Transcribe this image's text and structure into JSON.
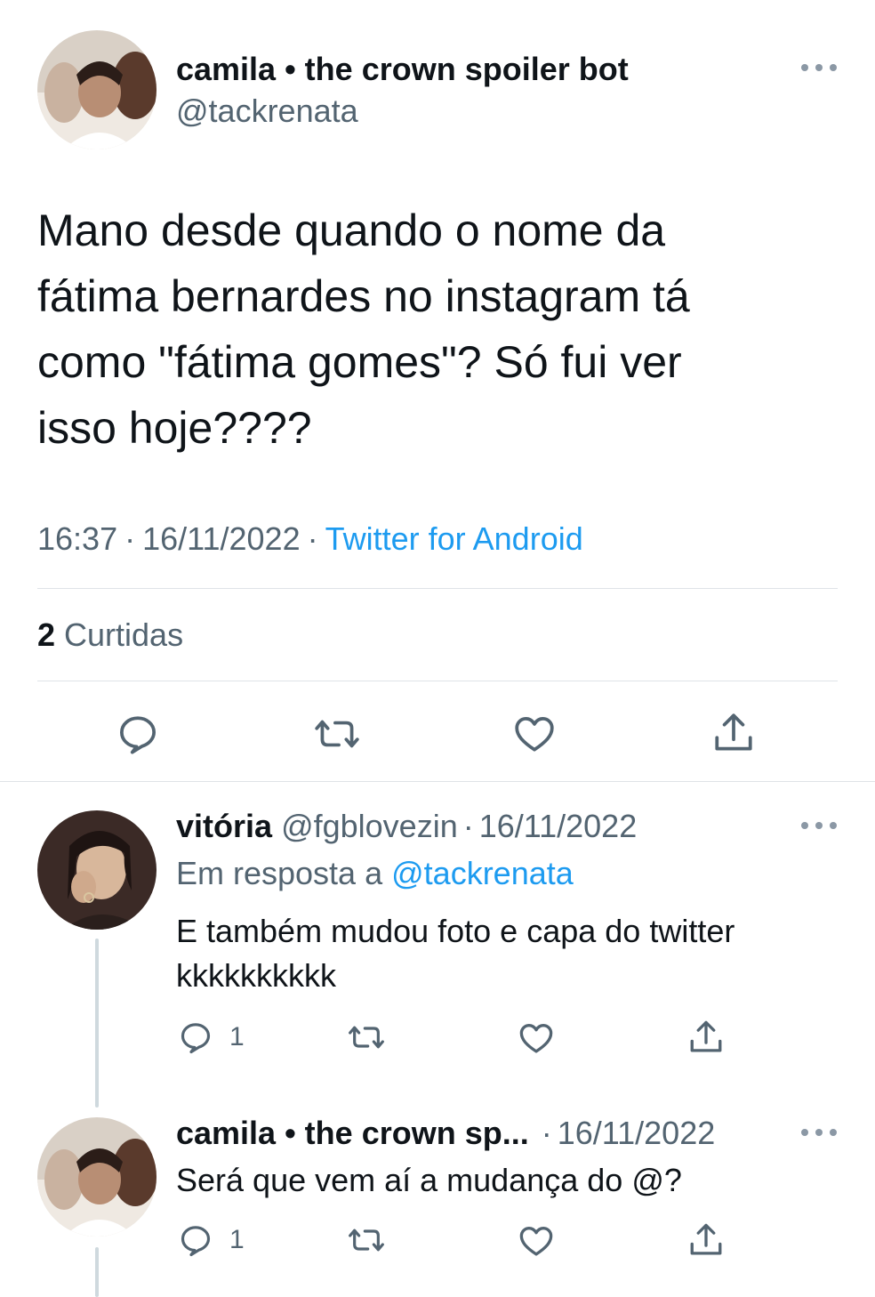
{
  "main_tweet": {
    "display_name": "camila • the crown spoiler bot",
    "handle": "@tackrenata",
    "text_lines": [
      "Mano desde quando o nome da",
      "fátima bernardes no instagram tá",
      "como \"fátima gomes\"? Só fui ver",
      "isso hoje????"
    ],
    "time": "16:37",
    "date": "16/11/2022",
    "separator": "·",
    "source": "Twitter for Android",
    "likes_count": "2",
    "likes_label": "Curtidas",
    "actions": [
      "reply-icon",
      "retweet-icon",
      "like-icon",
      "share-icon"
    ]
  },
  "replies": [
    {
      "display_name": "vitória",
      "handle": "@fgblovezin",
      "separator": "·",
      "date": "16/11/2022",
      "reply_to_label": "Em resposta a",
      "reply_to_handle": "@tackrenata",
      "text_lines": [
        "E também mudou foto e capa do twitter",
        "kkkkkkkkkk"
      ],
      "reply_count": "1"
    },
    {
      "display_name": "camila • the crown sp...",
      "separator": "·",
      "date": "16/11/2022",
      "text_lines": [
        "Será que vem aí a mudança do @?"
      ],
      "reply_count": "1"
    }
  ],
  "colors": {
    "text": "#0f1419",
    "muted": "#536471",
    "link": "#1d9bf0",
    "divider": "#dfe3e7"
  }
}
